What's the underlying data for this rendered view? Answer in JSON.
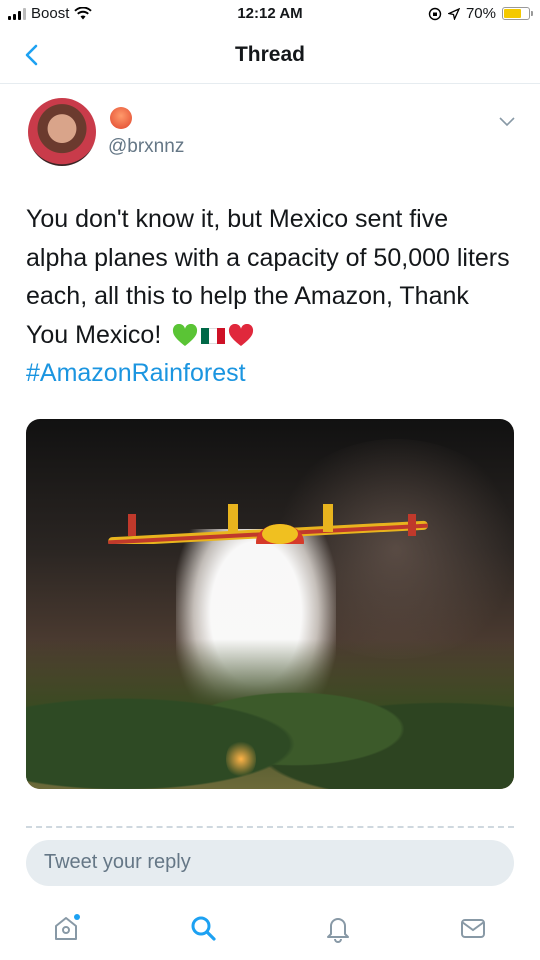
{
  "status_bar": {
    "carrier": "Boost",
    "time": "12:12 AM",
    "battery_percent": "70%",
    "battery_level": 0.7
  },
  "nav": {
    "title": "Thread",
    "back_icon": "chevron-left-icon"
  },
  "tweet": {
    "handle": "@brxnnz",
    "text": "You don't know it, but Mexico sent five alpha planes with a capacity of 50,000 liters each, all this to help the Amazon, Thank You Mexico!",
    "emojis": [
      "green-heart",
      "mexico-flag",
      "red-heart"
    ],
    "hashtag": "#AmazonRainforest",
    "image_description_icon": "firefighting-plane-photo"
  },
  "reply": {
    "placeholder": "Tweet your reply"
  },
  "tabs": [
    {
      "name": "home",
      "icon": "home-icon"
    },
    {
      "name": "search",
      "icon": "search-icon"
    },
    {
      "name": "notifications",
      "icon": "bell-icon"
    },
    {
      "name": "messages",
      "icon": "mail-icon"
    }
  ],
  "colors": {
    "accent": "#1da1f2",
    "hashtag": "#1b95e0",
    "battery": "#f4c900",
    "secondary_text": "#657786"
  }
}
